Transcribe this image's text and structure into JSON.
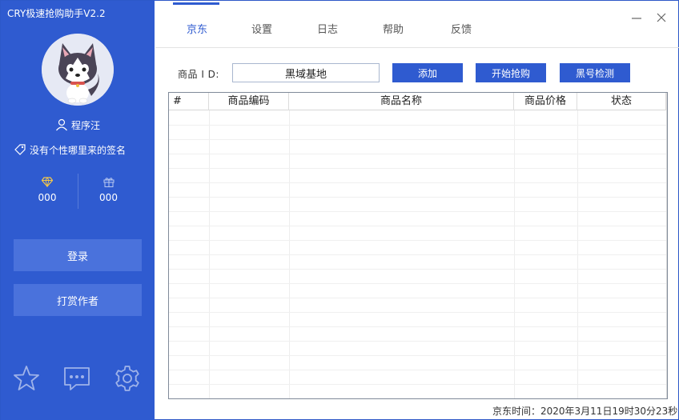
{
  "app": {
    "title": "CRY极速抢购助手V2.2"
  },
  "sidebar": {
    "username": "程序汪",
    "signature": "没有个性哪里来的签名",
    "stats": [
      {
        "icon": "diamond-icon",
        "value": "000"
      },
      {
        "icon": "gift-icon",
        "value": "000"
      }
    ],
    "login_label": "登录",
    "tip_label": "打赏作者",
    "bottom_icons": [
      "star-icon",
      "chat-icon",
      "gear-icon"
    ]
  },
  "nav": {
    "tabs": [
      {
        "label": "京东",
        "active": true
      },
      {
        "label": "设置",
        "active": false
      },
      {
        "label": "日志",
        "active": false
      },
      {
        "label": "帮助",
        "active": false
      },
      {
        "label": "反馈",
        "active": false
      }
    ]
  },
  "toolbar": {
    "product_id_label": "商品 I D:",
    "product_id_value": "黑域基地",
    "add_label": "添加",
    "start_label": "开始抢购",
    "check_label": "黑号检测"
  },
  "table": {
    "columns": [
      "#",
      "商品编码",
      "商品名称",
      "商品价格",
      "状态"
    ],
    "rows": []
  },
  "status": {
    "text": "京东时间：2020年3月11日19时30分23秒"
  },
  "colors": {
    "accent": "#2f5bd0",
    "sidebar": "#2f5bd0",
    "side_button": "#4a72dc"
  }
}
